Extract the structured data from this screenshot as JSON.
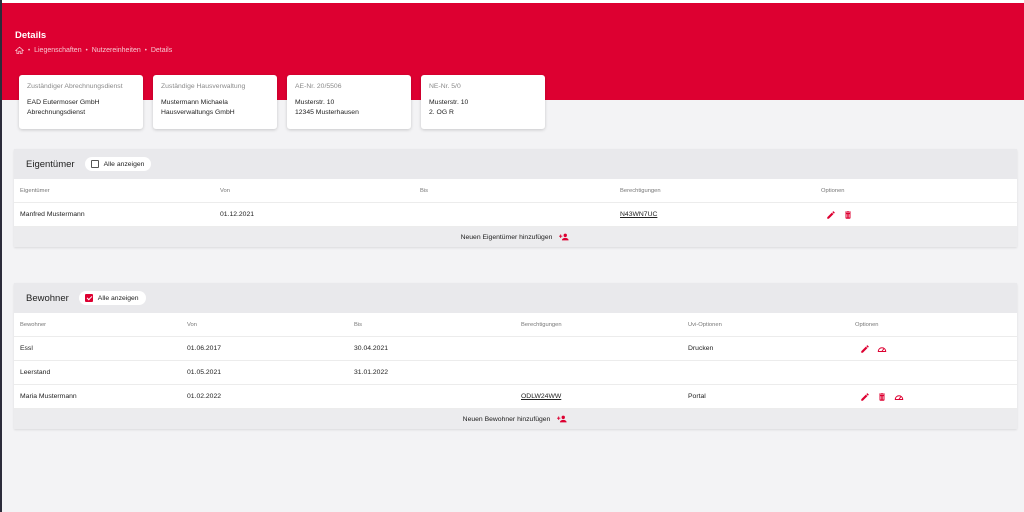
{
  "header": {
    "title": "Details",
    "breadcrumb": [
      "Liegenschaften",
      "Nutzereinheiten",
      "Details"
    ]
  },
  "cards": [
    {
      "label": "Zuständiger Abrechnungsdienst",
      "lines": [
        "EAD Eutermoser GmbH",
        "Abrechnungsdienst"
      ]
    },
    {
      "label": "Zuständige Hausverwaltung",
      "lines": [
        "Mustermann Michaela",
        "Hausverwaltungs GmbH"
      ]
    },
    {
      "label": "AE-Nr. 20/5506",
      "lines": [
        "Musterstr. 10",
        "12345 Musterhausen"
      ]
    },
    {
      "label": "NE-Nr. 5/0",
      "lines": [
        "Musterstr. 10",
        "2. OG R"
      ]
    }
  ],
  "owners": {
    "title": "Eigentümer",
    "show_all_label": "Alle anzeigen",
    "show_all_checked": false,
    "columns": [
      "Eigentümer",
      "Von",
      "Bis",
      "Berechtigungen",
      "Optionen"
    ],
    "rows": [
      {
        "name": "Manfred Mustermann",
        "from": "01.12.2021",
        "to": "",
        "code": "N43WN7UC"
      }
    ],
    "add_label": "Neuen Eigentümer hinzufügen"
  },
  "residents": {
    "title": "Bewohner",
    "show_all_label": "Alle anzeigen",
    "show_all_checked": true,
    "columns": [
      "Bewohner",
      "Von",
      "Bis",
      "Berechtigungen",
      "Uvi-Optionen",
      "Optionen"
    ],
    "rows": [
      {
        "name": "Essl",
        "from": "01.06.2017",
        "to": "30.04.2021",
        "code": "",
        "uvi": "Drucken"
      },
      {
        "name": "Leerstand",
        "from": "01.05.2021",
        "to": "31.01.2022",
        "code": "",
        "uvi": ""
      },
      {
        "name": "Maria Mustermann",
        "from": "01.02.2022",
        "to": "",
        "code": "ODLW24WW",
        "uvi": "Portal"
      }
    ],
    "add_label": "Neuen Bewohner hinzufügen"
  },
  "colors": {
    "brand": "#dd0031",
    "background": "#f3f3f5"
  },
  "icons": [
    "home-icon",
    "edit-icon",
    "delete-icon",
    "meter-icon",
    "add-person-icon"
  ]
}
